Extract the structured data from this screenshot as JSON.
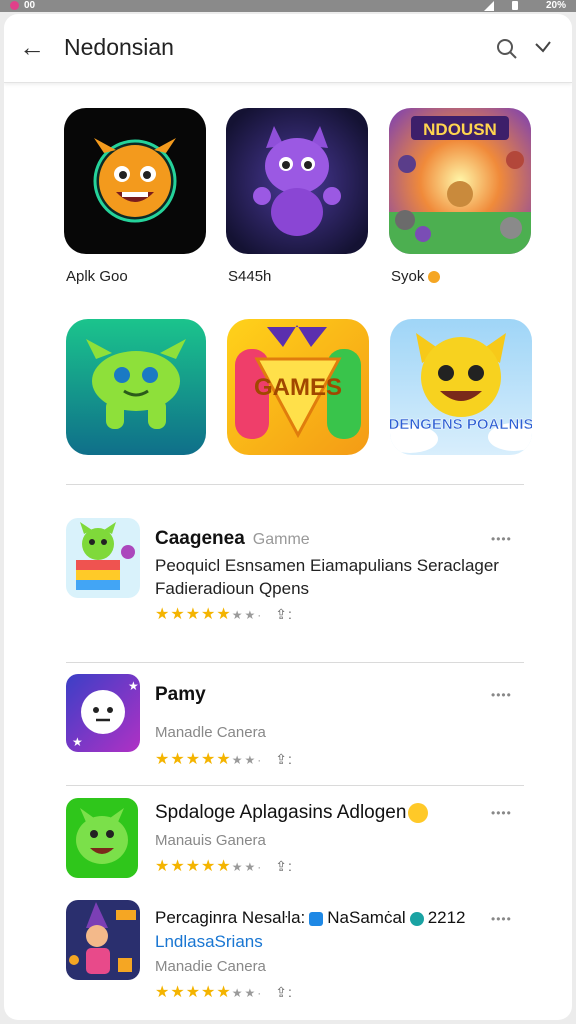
{
  "statusbar": {
    "left": "00",
    "right": "20%"
  },
  "appbar": {
    "title": "Nedonsian"
  },
  "grid": [
    {
      "label": "Aplk Goo",
      "icon": "orange-monster-icon"
    },
    {
      "label": "S445h",
      "icon": "purple-creature-icon"
    },
    {
      "label": "Syok",
      "icon": "ndousn-banner-icon"
    },
    {
      "label": "",
      "icon": "green-monster-icon"
    },
    {
      "label": "",
      "icon": "games-controller-icon",
      "icon_text": "GAMES"
    },
    {
      "label": "",
      "icon": "yellow-cat-icon",
      "icon_text": "DENGENS POALNIS"
    }
  ],
  "grid_tile_3_text": "NDOUSN",
  "list": [
    {
      "title": "Caagenea",
      "tag": "Gamme",
      "subtitle": "Peoquicl Esnsamen Eiamapulians Seraclager Fadieradioun Qpens",
      "stars_full": 5,
      "stars_text": "★★★★★",
      "gray": "★★·",
      "dl": "⇪:"
    },
    {
      "title": "Pamy",
      "gray_text": "Manadle Canera",
      "stars_text": "★★★★★",
      "gray": "★★·",
      "dl": "⇪:"
    },
    {
      "title": "Spdaloge Aplagasins Adlogen",
      "gray_text": "Manauis Ganera",
      "stars_text": "★★★★★",
      "gray": "★★·",
      "dl": "⇪:"
    },
    {
      "title": "Percaginra Nesaŀla:",
      "badge1_text": "NaSamċal",
      "badge2_text": "2212",
      "blue_text": "LndlasaSrians",
      "gray_text": "Manadie Canera",
      "stars_text": "★★★★★",
      "gray": "★★·",
      "dl": "⇪:"
    }
  ],
  "dots": "••••"
}
